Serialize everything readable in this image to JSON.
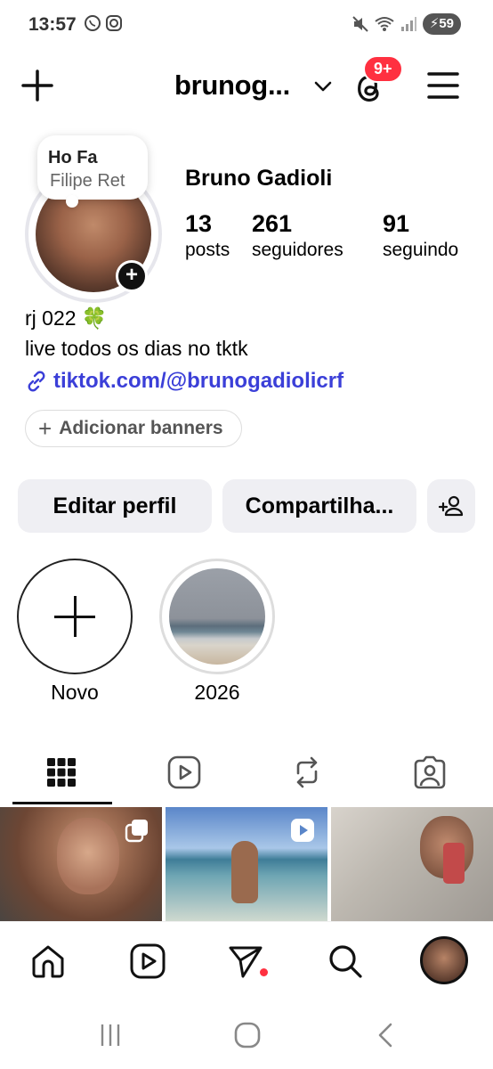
{
  "status_bar": {
    "time": "13:57",
    "battery": "59"
  },
  "header": {
    "username": "brunog...",
    "threads_badge": "9+"
  },
  "profile": {
    "note_line1": "Ho Fa",
    "note_line2": "Filipe Ret",
    "display_name": "Bruno Gadioli",
    "stats": [
      {
        "value": "13",
        "label": "posts"
      },
      {
        "value": "261",
        "label": "seguidores"
      },
      {
        "value": "91",
        "label": "seguindo"
      }
    ],
    "bio_line1": "rj 022 🍀",
    "bio_line2": "live todos os dias no tktk",
    "link_text": "tiktok.com/@brunogadiolicrf",
    "add_banners_label": "Adicionar banners"
  },
  "actions": {
    "edit_label": "Editar perfil",
    "share_label": "Compartilha..."
  },
  "highlights": [
    {
      "label": "Novo"
    },
    {
      "label": "2026"
    }
  ],
  "tabs": [
    {
      "icon": "grid-icon"
    },
    {
      "icon": "reels-icon"
    },
    {
      "icon": "reposts-icon"
    },
    {
      "icon": "tagged-icon"
    }
  ],
  "colors": {
    "accent_link": "#3b3fd8",
    "badge_red": "#ff3040",
    "button_bg": "#efeff3"
  }
}
